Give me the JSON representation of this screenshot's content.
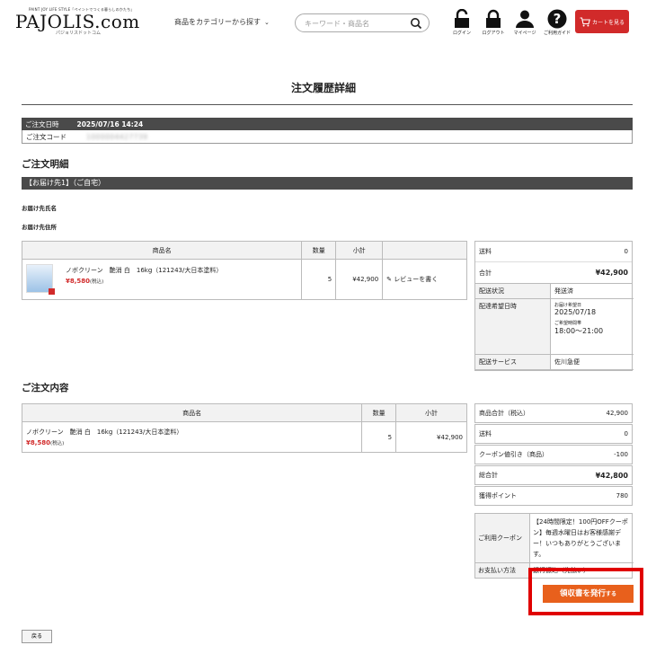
{
  "header": {
    "tagline": "PAINT JOY LIFE STYLE「ペイントでつくる暮らしのかたち」",
    "logo": "PAJOLIS.com",
    "logo_sub": "パジョリスドットコム",
    "category_menu": "商品をカテゴリーから探す",
    "search_placeholder": "キーワード・商品名",
    "icons": {
      "login": "ログイン",
      "logout": "ログアウト",
      "mypage": "マイページ",
      "guide": "ご利用ガイド"
    },
    "cart": "カートを見る"
  },
  "page_title": "注文履歴詳細",
  "order_meta": {
    "date_label": "ご注文日時",
    "date_value": "2025/07/16 14:24",
    "code_label": "ご注文コード",
    "code_value": "1000004427739"
  },
  "detail_section": {
    "heading": "ご注文明細",
    "destination_bar": "【お届け先1】（ご自宅）",
    "name_label": "お届け先氏名",
    "address_label": "お届け先住所"
  },
  "detail_table": {
    "headers": [
      "商品名",
      "数量",
      "小計",
      ""
    ],
    "row": {
      "name": "ノボクリーン　艶消 白　16kg（121243/大日本塗料）",
      "price": "¥8,580",
      "tax": "(税込)",
      "qty": "5",
      "subtotal": "¥42,900",
      "review": "レビューを書く"
    }
  },
  "shipping_box": {
    "shipping_label": "送料",
    "shipping_value": "0",
    "total_label": "合計",
    "total_value": "¥42,900",
    "status_label": "配送状況",
    "status_value": "発送済",
    "desired_label": "配達希望日時",
    "desired_date_caption": "お届け希望日",
    "desired_date": "2025/07/18",
    "desired_time_caption": "ご希望時間帯",
    "desired_time": "18:00〜21:00",
    "service_label": "配送サービス",
    "service_value": "佐川急便"
  },
  "content_section": {
    "heading": "ご注文内容"
  },
  "content_table": {
    "headers": [
      "商品名",
      "数量",
      "小計"
    ],
    "row": {
      "name": "ノボクリーン　艶消 白　16kg（121243/大日本塗料）",
      "price": "¥8,580",
      "tax": "(税込)",
      "qty": "5",
      "subtotal": "¥42,900"
    }
  },
  "summary_box": {
    "rows": [
      {
        "label": "商品合計（税込）",
        "value": "42,900",
        "strong": false
      },
      {
        "label": "送料",
        "value": "0",
        "strong": false
      },
      {
        "label": "クーポン値引き（商品）",
        "value": "-100",
        "strong": false
      },
      {
        "label": "総合計",
        "value": "¥42,800",
        "strong": true
      },
      {
        "label": "獲得ポイント",
        "value": "780",
        "strong": false
      }
    ],
    "coupon_label": "ご利用クーポン",
    "coupon_value": "【24時間限定！100円OFFクーポン】毎週水曜日はお客様感謝デー！いつもありがとうございます。",
    "payment_label": "お支払い方法",
    "payment_value": "銀行振込（先払い）"
  },
  "receipt_button": {
    "main": "領収書を発行",
    "suffix": "する"
  },
  "back_button": "戻る",
  "colors": {
    "accent_red": "#d12a2a",
    "receipt_orange": "#e8601c",
    "highlight_border": "#e00000",
    "bar_dark": "#4a4a4a"
  }
}
